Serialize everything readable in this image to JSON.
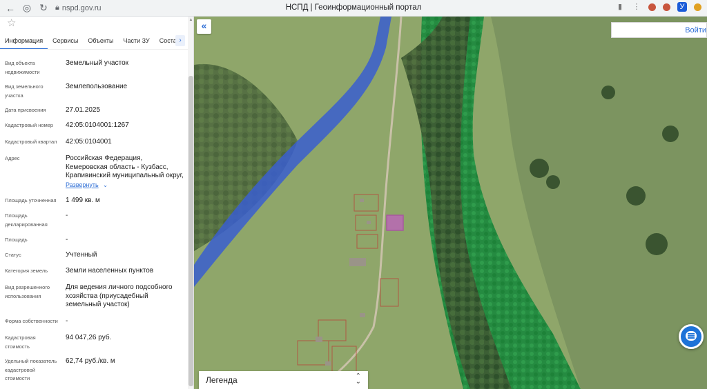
{
  "browser": {
    "url": "nspd.gov.ru",
    "title": "НСПД | Геоинформационный портал"
  },
  "tabs": [
    "Информация",
    "Сервисы",
    "Объекты",
    "Части ЗУ",
    "Соста"
  ],
  "fields": [
    {
      "label": "Вид объекта недвижимости",
      "value": [
        "Земельный участок"
      ]
    },
    {
      "label": "Вид земельного участка",
      "value": [
        "Землепользование"
      ]
    },
    {
      "label": "Дата присвоения",
      "value": [
        "27.01.2025"
      ]
    },
    {
      "label": "Кадастровый номер",
      "value": [
        "42:05:0104001:1267"
      ]
    },
    {
      "label": "Кадастровый квартал",
      "value": [
        "42:05:0104001"
      ]
    },
    {
      "label": "Адрес",
      "value": [
        "Российская Федерация,",
        "Кемеровская область - Кузбасс,",
        "Крапивинский муниципальный округ,"
      ]
    },
    {
      "label": "Площадь уточненная",
      "value": [
        "1 499 кв. м"
      ]
    },
    {
      "label": "Площадь декларированная",
      "value": [
        "-"
      ]
    },
    {
      "label": "Площадь",
      "value": [
        "-"
      ]
    },
    {
      "label": "Статус",
      "value": [
        "Учтенный"
      ]
    },
    {
      "label": "Категория земель",
      "value": [
        "Земли населенных пунктов"
      ]
    },
    {
      "label": "Вид разрешенного использования",
      "value": [
        "Для ведения личного подсобного",
        "хозяйства (приусадебный",
        "земельный участок)"
      ]
    },
    {
      "label": "Форма собственности",
      "value": [
        "-"
      ]
    },
    {
      "label": "Кадастровая стоимость",
      "value": [
        "94 047,26 руб."
      ]
    },
    {
      "label": "Удельный показатель кадастровой стоимости",
      "value": [
        "62,74 руб./кв. м"
      ]
    }
  ],
  "address_expand": "Развернуть",
  "map": {
    "login_label": "Войти",
    "legend_label": "Легенда"
  },
  "colors": {
    "accent": "#2f6fd6",
    "forest_overlay": "#22c25a",
    "water_overlay": "#3a5ecf"
  }
}
